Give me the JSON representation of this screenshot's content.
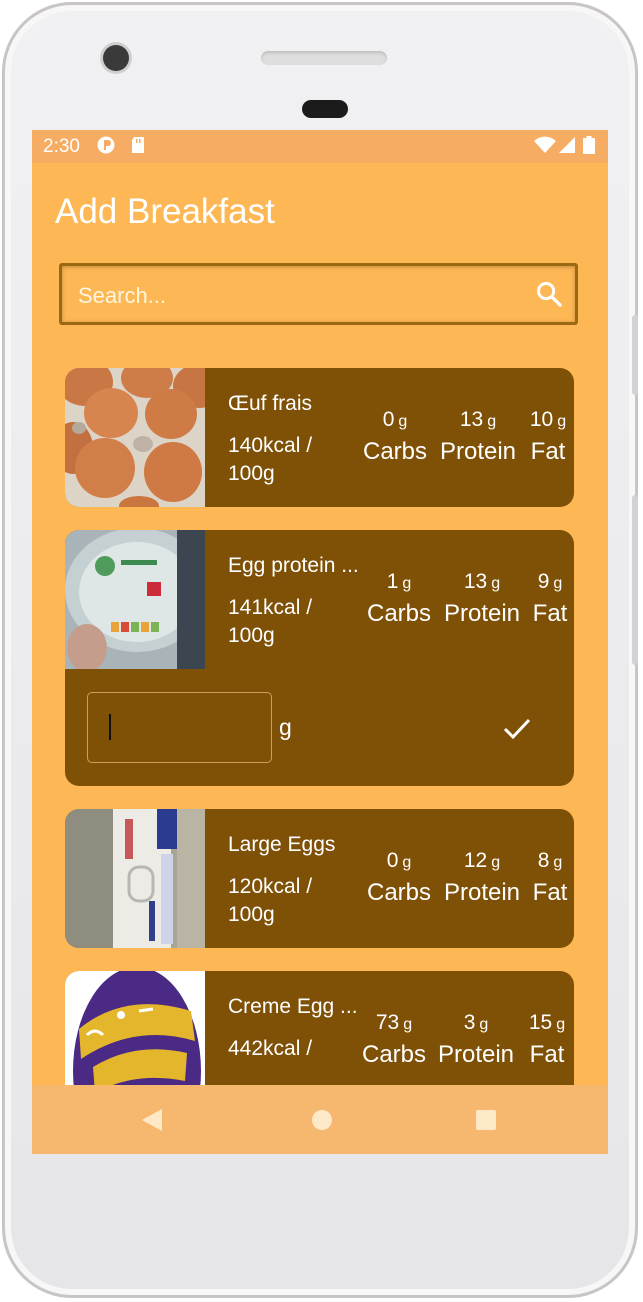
{
  "status_bar": {
    "time": "2:30",
    "icons": [
      "notification-icon",
      "sd-card-icon",
      "wifi-icon",
      "signal-icon",
      "battery-icon"
    ]
  },
  "header": {
    "title": "Add Breakfast"
  },
  "search": {
    "placeholder": "Search...",
    "icon": "search-icon"
  },
  "foods": [
    {
      "name": "Œuf frais",
      "kcal": "140kcal / 100g",
      "carbs": "0",
      "protein": "13",
      "fat": "10"
    },
    {
      "name": "Egg protein ...",
      "kcal": "141kcal / 100g",
      "carbs": "1",
      "protein": "13",
      "fat": "9",
      "expanded": true
    },
    {
      "name": "Large Eggs",
      "kcal": "120kcal / 100g",
      "carbs": "0",
      "protein": "12",
      "fat": "8"
    },
    {
      "name": "Creme Egg ...",
      "kcal": "442kcal /",
      "carbs": "73",
      "protein": "3",
      "fat": "15"
    }
  ],
  "macro_labels": {
    "carbs": "Carbs",
    "protein": "Protein",
    "fat": "Fat",
    "unit": "g"
  },
  "quantity": {
    "value": "",
    "unit": "g"
  },
  "colors": {
    "background": "#fdb754",
    "card": "#7f5107",
    "status_bar": "#f6ac62",
    "nav_bar": "#f6b76e"
  },
  "nav_bar": {
    "buttons": [
      "back-icon",
      "home-icon",
      "recents-icon"
    ]
  }
}
